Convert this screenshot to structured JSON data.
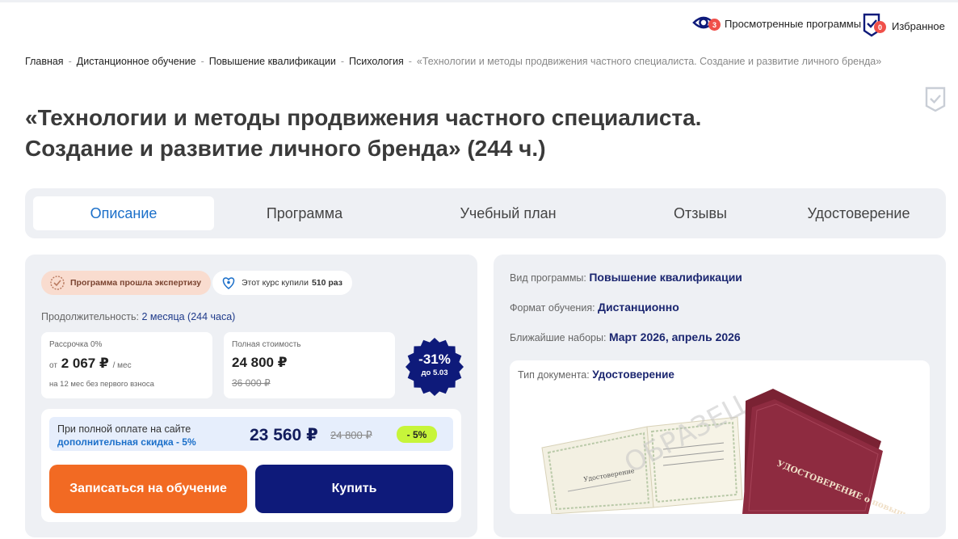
{
  "topbar": {
    "viewed_label": "Просмотренные программы",
    "viewed_count": "3",
    "favorites_label": "Избранное",
    "favorites_count": "0"
  },
  "breadcrumb": {
    "items": [
      "Главная",
      "Дистанционное обучение",
      "Повышение квалификации",
      "Психология"
    ],
    "current": "«Технологии и методы продвижения частного специалиста. Создание и развитие личного бренда»",
    "separator": "-"
  },
  "title": {
    "line1": "«Технологии и методы продвижения частного специалиста.",
    "line2": "Создание и развитие личного бренда» (244 ч.)"
  },
  "tabs": [
    {
      "label": "Описание",
      "active": true
    },
    {
      "label": "Программа",
      "active": false
    },
    {
      "label": "Учебный план",
      "active": false
    },
    {
      "label": "Отзывы",
      "active": false
    },
    {
      "label": "Удостоверение",
      "active": false
    }
  ],
  "offer": {
    "expert_badge": "Программа прошла экспертизу",
    "bought_prefix": "Этот курс купили",
    "bought_count": "510 раз",
    "duration_label": "Продолжительность:",
    "duration_value": "2 месяца (244 часа)",
    "installment": {
      "label": "Рассрочка 0%",
      "from": "от",
      "price": "2 067 ₽",
      "per": "/ мес",
      "note": "на 12 мес без первого взноса"
    },
    "full": {
      "label": "Полная стоимость",
      "price": "24 800 ₽",
      "old_price": "36 000 ₽"
    },
    "discount": {
      "percent": "-31%",
      "until": "до 5.03",
      "color": "#0e1a7a"
    },
    "site_payment": {
      "line1": "При полной оплате на сайте",
      "line2": "дополнительная скидка - 5%",
      "new_price": "23 560 ₽",
      "old_price": "24 800 ₽",
      "percent": "- 5%"
    },
    "enroll_button": "Записаться на обучение",
    "buy_button": "Купить"
  },
  "info": {
    "program_type_label": "Вид программы:",
    "program_type_value": "Повышение квалификации",
    "format_label": "Формат обучения:",
    "format_value": "Дистанционно",
    "intake_label": "Ближайшие наборы:",
    "intake_value": "Март 2026, апрель 2026",
    "doc_type_label": "Тип документа:",
    "doc_type_value": "Удостоверение",
    "doc_cover_text": "УДОСТОВЕРЕНИЕ о повышении квалификации",
    "doc_inner_text": "Удостоверение",
    "watermark": "ОБРАЗЕЦ"
  },
  "colors": {
    "accent_blue": "#1b6fc9",
    "navy": "#0e1a7a",
    "orange": "#f26a23",
    "lime": "#c7f53a",
    "panel_bg": "#eef0f4",
    "badge_red": "#f0504a"
  }
}
